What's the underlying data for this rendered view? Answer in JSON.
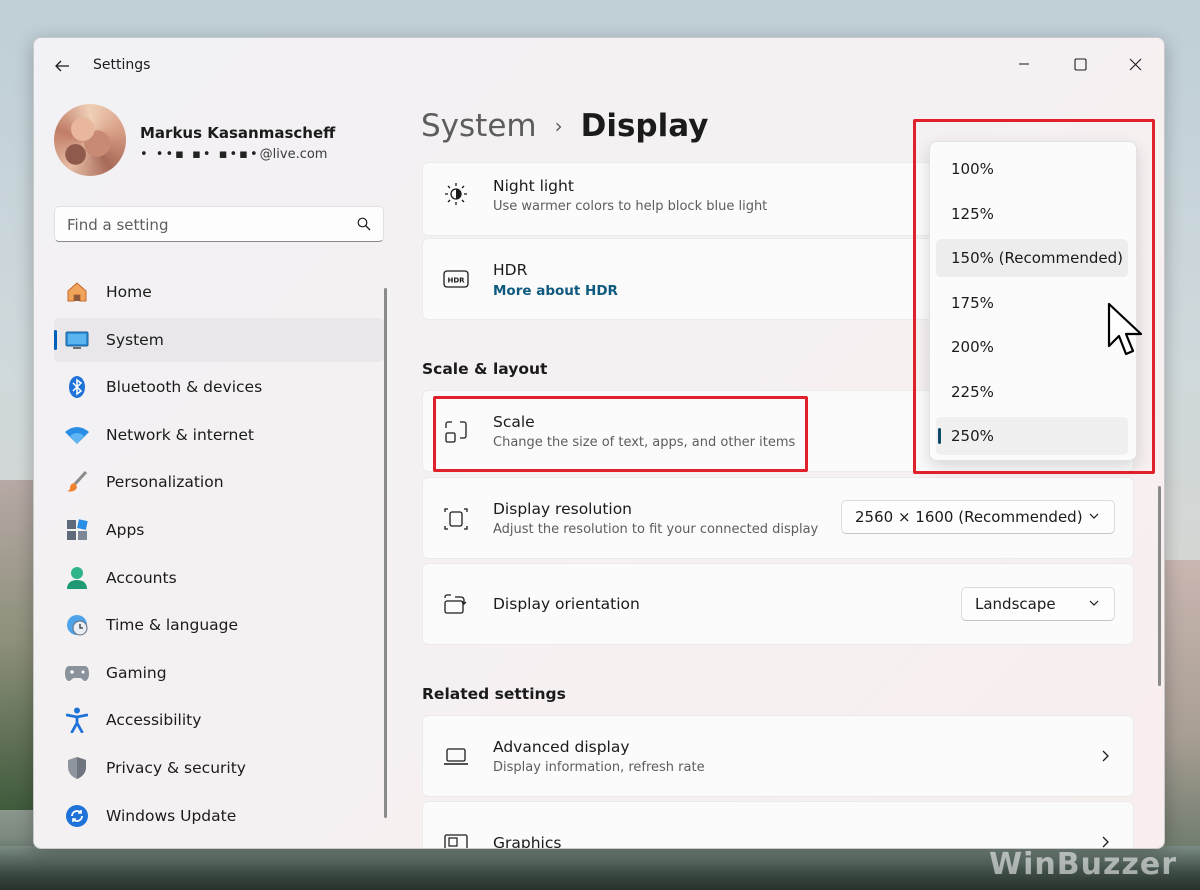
{
  "window": {
    "title": "Settings"
  },
  "profile": {
    "name": "Markus Kasanmascheff",
    "email_masked": "• ••▪ ▪• ▪•▪•",
    "email_suffix": "@live.com"
  },
  "search": {
    "placeholder": "Find a setting"
  },
  "sidebar": {
    "items": [
      {
        "label": "Home",
        "icon": "home-icon"
      },
      {
        "label": "System",
        "icon": "monitor-icon",
        "active": true
      },
      {
        "label": "Bluetooth & devices",
        "icon": "bluetooth-icon"
      },
      {
        "label": "Network & internet",
        "icon": "wifi-icon"
      },
      {
        "label": "Personalization",
        "icon": "brush-icon"
      },
      {
        "label": "Apps",
        "icon": "apps-icon"
      },
      {
        "label": "Accounts",
        "icon": "person-icon"
      },
      {
        "label": "Time & language",
        "icon": "clock-globe-icon"
      },
      {
        "label": "Gaming",
        "icon": "gamepad-icon"
      },
      {
        "label": "Accessibility",
        "icon": "accessibility-icon"
      },
      {
        "label": "Privacy & security",
        "icon": "shield-icon"
      },
      {
        "label": "Windows Update",
        "icon": "update-icon"
      }
    ]
  },
  "breadcrumb": {
    "parent": "System",
    "separator": "›",
    "current": "Display"
  },
  "cards": {
    "night_light": {
      "title": "Night light",
      "subtitle": "Use warmer colors to help block blue light"
    },
    "hdr": {
      "title": "HDR",
      "link": "More about HDR"
    },
    "scale": {
      "title": "Scale",
      "subtitle": "Change the size of text, apps, and other items"
    },
    "resolution": {
      "title": "Display resolution",
      "subtitle": "Adjust the resolution to fit your connected display",
      "value": "2560 × 1600 (Recommended)"
    },
    "orientation": {
      "title": "Display orientation",
      "value": "Landscape"
    },
    "advanced": {
      "title": "Advanced display",
      "subtitle": "Display information, refresh rate"
    },
    "graphics": {
      "title": "Graphics"
    }
  },
  "sections": {
    "scale_layout": "Scale & layout",
    "related": "Related settings"
  },
  "scale_flyout": {
    "options": [
      "100%",
      "125%",
      "150% (Recommended)",
      "175%",
      "200%",
      "225%",
      "250%"
    ],
    "selected": "250%",
    "hovered": "150% (Recommended)"
  },
  "colors": {
    "accent": "#005fb8",
    "highlight_box": "#e0202a",
    "link": "#0e5a7e"
  },
  "watermark": {
    "text": "WinBuzzer"
  }
}
